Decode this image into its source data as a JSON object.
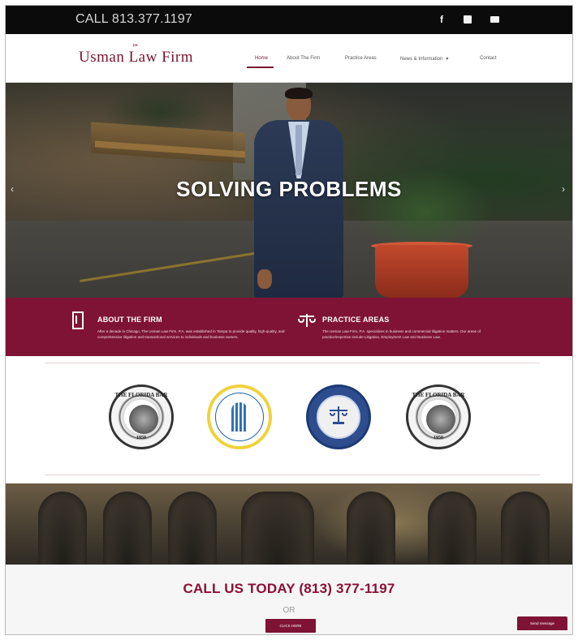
{
  "topbar": {
    "phone": "CALL 813.377.1197",
    "social_icons": [
      "facebook-icon",
      "linkedin-icon",
      "email-icon"
    ]
  },
  "header": {
    "logo_text": "Usman Law Firm",
    "logo_mark": "pa",
    "nav": [
      {
        "label": "Home",
        "active": true
      },
      {
        "label": "About The Firm"
      },
      {
        "label": "Practice Areas"
      },
      {
        "label": "News & Information",
        "has_dropdown": true
      },
      {
        "label": "Contact"
      }
    ]
  },
  "hero": {
    "title": "SOLVING PROBLEMS",
    "prev_icon": "chevron-left-icon",
    "next_icon": "chevron-right-icon"
  },
  "band": {
    "about": {
      "title": "ABOUT THE FIRM",
      "text": "After a decade in Chicago, The Usman Law Firm, P.A. was established in Tampa to provide quality, high-quality, and comprehensive litigation and transactional services to individuals and business owners."
    },
    "practice": {
      "title": "PRACTICE AREAS",
      "text": "The Usman Law Firm, P.A. specializes in business and commercial litigation matters. Our areas of practice/expertise include Litigation, Employment Law and Business Law."
    }
  },
  "seals": {
    "florida_bar_1": {
      "ring_text": "THE FLORIDA BAR",
      "date": "1950"
    },
    "florida_bar_2": {
      "ring_text": "THE FLORIDA BAR",
      "date": "1950"
    }
  },
  "call": {
    "title": "CALL US TODAY (813) 377-1197",
    "or": "OR",
    "button": "CLICK HERE"
  },
  "send_message": "Send message",
  "colors": {
    "brand": "#7e1336",
    "topbar": "#0b0b0b",
    "accent_gold": "#f0d23a",
    "seal_blue": "#2d4d8f"
  }
}
